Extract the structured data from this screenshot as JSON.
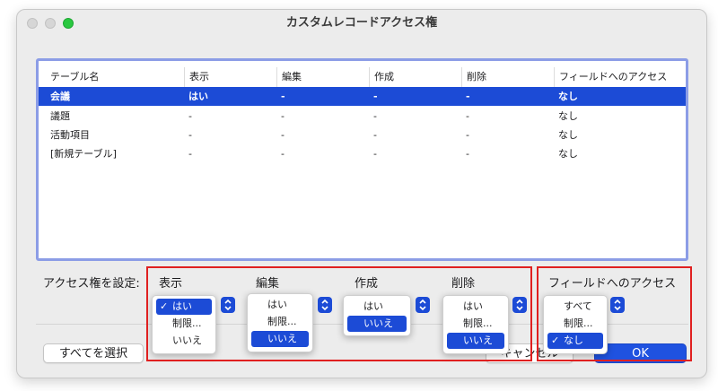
{
  "window": {
    "title": "カスタムレコードアクセス権"
  },
  "table": {
    "headers": [
      "テーブル名",
      "表示",
      "編集",
      "作成",
      "削除",
      "フィールドへのアクセス"
    ],
    "rows": [
      [
        "会議",
        "はい",
        "-",
        "-",
        "-",
        "なし"
      ],
      [
        "議題",
        "-",
        "-",
        "-",
        "-",
        "なし"
      ],
      [
        "活動項目",
        "-",
        "-",
        "-",
        "-",
        "なし"
      ],
      [
        "[新規テーブル]",
        "-",
        "-",
        "-",
        "-",
        "なし"
      ]
    ],
    "selected_row": 0
  },
  "settings": {
    "label": "アクセス権を設定:",
    "columns": {
      "view": {
        "label": "表示",
        "options": [
          "はい",
          "制限...",
          "いいえ"
        ],
        "selected": "はい"
      },
      "edit": {
        "label": "編集",
        "options": [
          "はい",
          "制限...",
          "いいえ"
        ],
        "selected": "いいえ"
      },
      "create": {
        "label": "作成",
        "options": [
          "はい",
          "いいえ"
        ],
        "selected": "いいえ"
      },
      "delete": {
        "label": "削除",
        "options": [
          "はい",
          "制限...",
          "いいえ"
        ],
        "selected": "いいえ"
      },
      "field_access": {
        "label": "フィールドへのアクセス",
        "options": [
          "すべて",
          "制限...",
          "なし"
        ],
        "selected": "なし"
      }
    },
    "checkmark": "✓"
  },
  "buttons": {
    "select_all": "すべてを選択",
    "cancel_partial": "キャンセル",
    "ok": "OK"
  },
  "colors": {
    "selection": "#1c4bd6",
    "highlight_box": "#e02020",
    "table_border": "#8c9de6"
  }
}
